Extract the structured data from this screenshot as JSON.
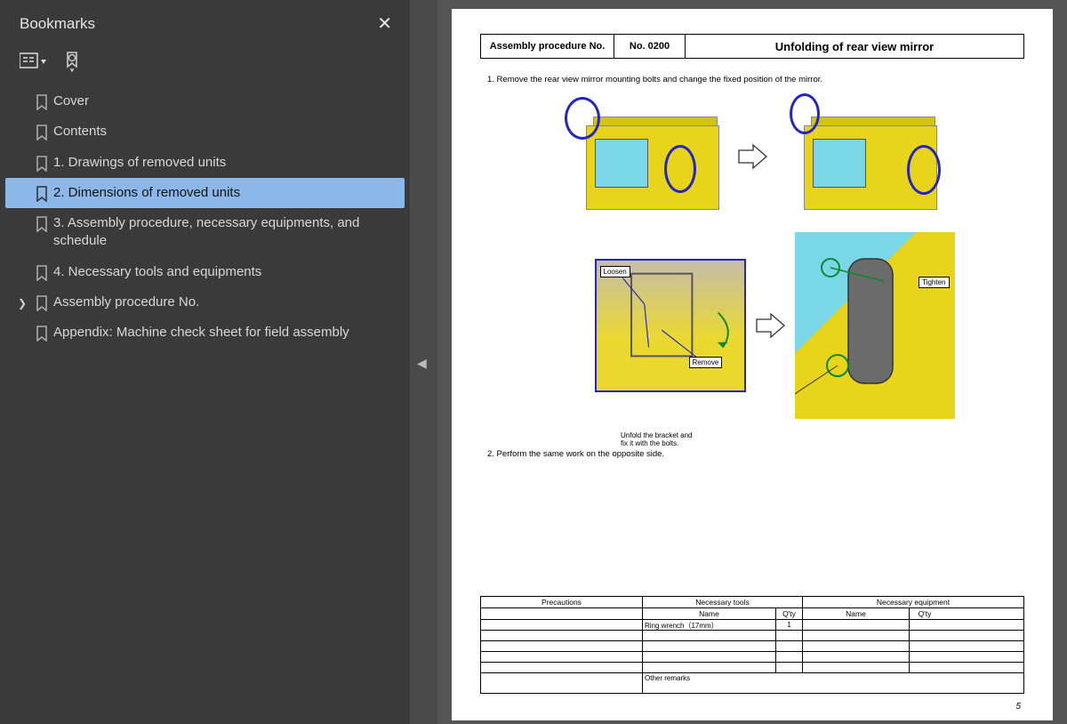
{
  "sidebar": {
    "title": "Bookmarks",
    "items": [
      {
        "label": "Cover",
        "selected": false,
        "hasChildren": false
      },
      {
        "label": "Contents",
        "selected": false,
        "hasChildren": false
      },
      {
        "label": "1. Drawings of removed units",
        "selected": false,
        "hasChildren": false
      },
      {
        "label": "2. Dimensions of removed units",
        "selected": true,
        "hasChildren": false
      },
      {
        "label": "3. Assembly procedure, necessary equipments, and schedule",
        "selected": false,
        "hasChildren": false
      },
      {
        "label": "4. Necessary tools and equipments",
        "selected": false,
        "hasChildren": false
      },
      {
        "label": "Assembly procedure No.",
        "selected": false,
        "hasChildren": true
      },
      {
        "label": "Appendix: Machine check sheet for field assembly",
        "selected": false,
        "hasChildren": false
      }
    ]
  },
  "document": {
    "header": {
      "label1": "Assembly procedure No.",
      "label2": "No. 0200",
      "title": "Unfolding of rear view mirror"
    },
    "step1": "1. Remove the rear view mirror mounting bolts and change the fixed position of the mirror.",
    "tags": {
      "loosen": "Loosen",
      "remove": "Remove",
      "tighten": "Tighten"
    },
    "note": "Unfold the bracket and fix it with the bolts.",
    "step2": "2. Perform the same work on the opposite side.",
    "table": {
      "precautions": "Precautions",
      "tools": "Necessary tools",
      "equip": "Necessary equipment",
      "name": "Name",
      "qty": "Q'ty",
      "rows": [
        {
          "tname": "Ring wrench（17mm）",
          "tqty": "1",
          "ename": "",
          "eqty": ""
        },
        {
          "tname": "",
          "tqty": "",
          "ename": "",
          "eqty": ""
        },
        {
          "tname": "",
          "tqty": "",
          "ename": "",
          "eqty": ""
        },
        {
          "tname": "",
          "tqty": "",
          "ename": "",
          "eqty": ""
        },
        {
          "tname": "",
          "tqty": "",
          "ename": "",
          "eqty": ""
        }
      ],
      "remarks": "Other remarks"
    },
    "pageNumber": "5"
  }
}
